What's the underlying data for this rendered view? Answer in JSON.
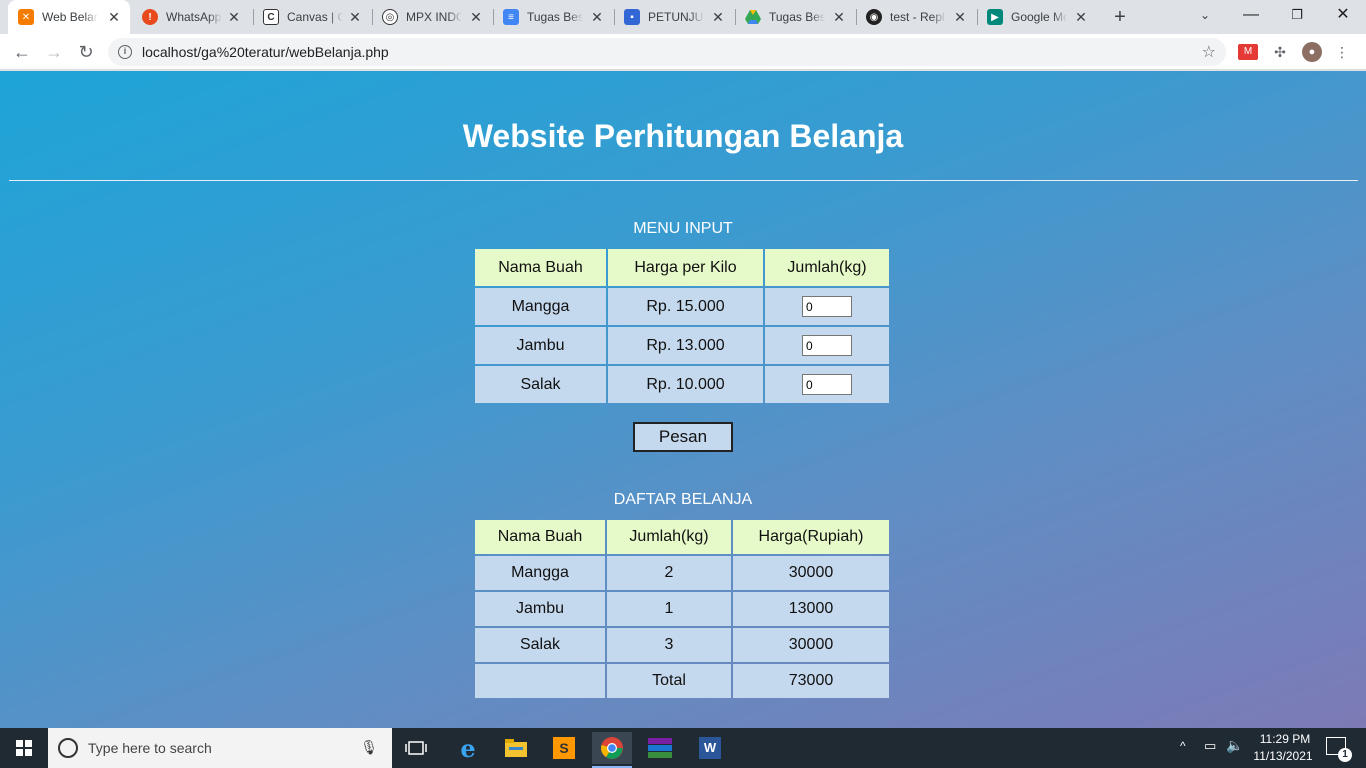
{
  "browser": {
    "tabs": [
      {
        "label": "Web Belanja",
        "active": true,
        "icon": "xampp-icon",
        "color": "#f57c00"
      },
      {
        "label": "WhatsApp",
        "active": false,
        "icon": "alert-icon",
        "color": "#e8491d"
      },
      {
        "label": "Canvas | Course",
        "active": false,
        "icon": "canvas-icon",
        "color": "#333333"
      },
      {
        "label": "MPX INDONESIA",
        "active": false,
        "icon": "mpx-icon",
        "color": "#333333"
      },
      {
        "label": "Tugas Besar",
        "active": false,
        "icon": "docs-icon",
        "color": "#4285f4"
      },
      {
        "label": "PETUNJUK",
        "active": false,
        "icon": "classroom-icon",
        "color": "#3367d6"
      },
      {
        "label": "Tugas Besar",
        "active": false,
        "icon": "drive-icon",
        "color": "#34a853"
      },
      {
        "label": "test - Replit",
        "active": false,
        "icon": "replit-icon",
        "color": "#222222"
      },
      {
        "label": "Google Meet",
        "active": false,
        "icon": "meet-icon",
        "color": "#00897b"
      }
    ],
    "new_tab": "+",
    "url": "localhost/ga%20teratur/webBelanja.php"
  },
  "page": {
    "title": "Website Perhitungan Belanja",
    "menu_input": {
      "heading": "MENU INPUT",
      "headers": [
        "Nama Buah",
        "Harga per Kilo",
        "Jumlah(kg)"
      ],
      "rows": [
        {
          "name": "Mangga",
          "price": "Rp. 15.000",
          "qty": "0"
        },
        {
          "name": "Jambu",
          "price": "Rp. 13.000",
          "qty": "0"
        },
        {
          "name": "Salak",
          "price": "Rp. 10.000",
          "qty": "0"
        }
      ],
      "submit_label": "Pesan"
    },
    "daftar_belanja": {
      "heading": "DAFTAR BELANJA",
      "headers": [
        "Nama Buah",
        "Jumlah(kg)",
        "Harga(Rupiah)"
      ],
      "rows": [
        {
          "name": "Mangga",
          "qty": "2",
          "price": "30000"
        },
        {
          "name": "Jambu",
          "qty": "1",
          "price": "13000"
        },
        {
          "name": "Salak",
          "qty": "3",
          "price": "30000"
        }
      ],
      "total_label": "Total",
      "total_value": "73000"
    }
  },
  "taskbar": {
    "search_placeholder": "Type here to search",
    "time": "11:29 PM",
    "date": "11/13/2021",
    "notification_count": "1"
  }
}
